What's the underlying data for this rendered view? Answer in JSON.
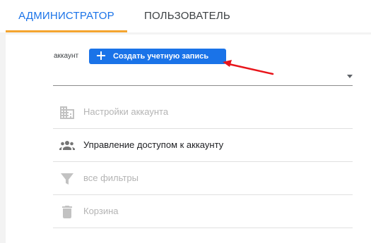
{
  "tabs": {
    "admin": "АДМИНИСТРАТОР",
    "user": "ПОЛЬЗОВАТЕЛЬ"
  },
  "account": {
    "label": "аккаунт",
    "create_button": "Создать учетную запись",
    "selected_value": ""
  },
  "menu": [
    {
      "label": "Настройки аккаунта",
      "icon": "building-icon",
      "enabled": false
    },
    {
      "label": "Управление доступом к аккаунту",
      "icon": "people-icon",
      "enabled": true
    },
    {
      "label": "все фильтры",
      "icon": "filter-icon",
      "enabled": false
    },
    {
      "label": "Корзина",
      "icon": "trash-icon",
      "enabled": false
    }
  ],
  "colors": {
    "accent_blue": "#1a73e8",
    "tab_underline": "#f4a430",
    "annotation_arrow": "#e8151b"
  }
}
